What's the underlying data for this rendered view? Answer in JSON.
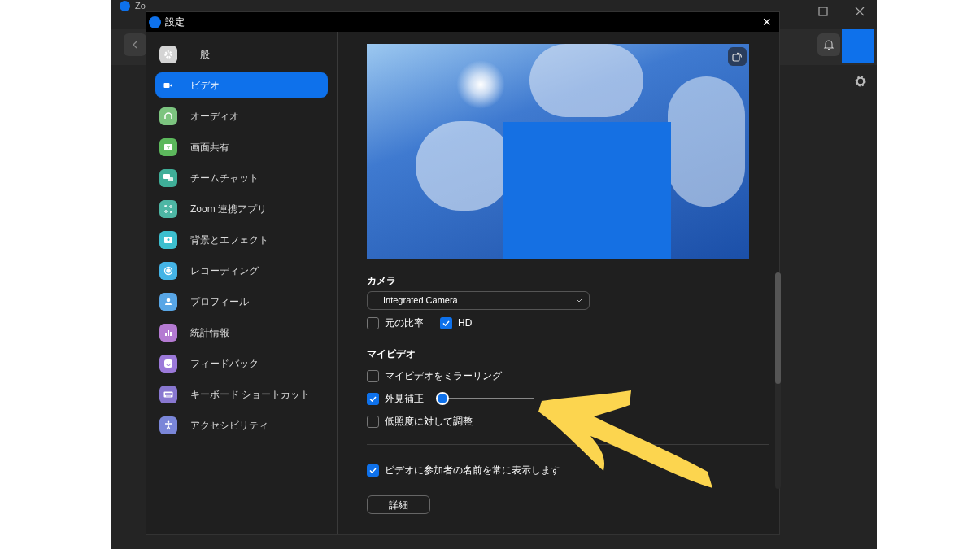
{
  "app_window": {
    "title": "Zo"
  },
  "dialog": {
    "title": "設定",
    "close": "×"
  },
  "sidebar": {
    "items": [
      {
        "label": "一般",
        "selected": false,
        "color": "#d4d4d4"
      },
      {
        "label": "ビデオ",
        "selected": true
      },
      {
        "label": "オーディオ",
        "selected": false,
        "color": "#7cc47f"
      },
      {
        "label": "画面共有",
        "selected": false,
        "color": "#5cb85c"
      },
      {
        "label": "チームチャット",
        "selected": false,
        "color": "#3fae98"
      },
      {
        "label": "Zoom 連携アプリ",
        "selected": false,
        "color": "#4db6a4"
      },
      {
        "label": "背景とエフェクト",
        "selected": false,
        "color": "#3cbfcf"
      },
      {
        "label": "レコーディング",
        "selected": false,
        "color": "#44b4e6"
      },
      {
        "label": "プロフィール",
        "selected": false,
        "color": "#58a6e6"
      },
      {
        "label": "統計情報",
        "selected": false,
        "color": "#b47ad2"
      },
      {
        "label": "フィードバック",
        "selected": false,
        "color": "#9b79d9"
      },
      {
        "label": "キーボード ショートカット",
        "selected": false,
        "color": "#8877d0"
      },
      {
        "label": "アクセシビリティ",
        "selected": false,
        "color": "#7a86d8"
      }
    ]
  },
  "camera": {
    "heading": "カメラ",
    "device": "Integrated Camera",
    "options": [
      {
        "label": "元の比率",
        "checked": false
      },
      {
        "label": "HD",
        "checked": true
      }
    ]
  },
  "my_video": {
    "heading": "マイビデオ",
    "options": [
      {
        "kind": "checkbox",
        "label": "マイビデオをミラーリング",
        "checked": false
      },
      {
        "kind": "slider",
        "label": "外見補正",
        "checked": true,
        "level": 0.0
      },
      {
        "kind": "checkbox",
        "label": "低照度に対して調整",
        "checked": false
      }
    ]
  },
  "names_option": {
    "label": "ビデオに参加者の名前を常に表示します",
    "checked": true
  },
  "details_button": "詳細"
}
